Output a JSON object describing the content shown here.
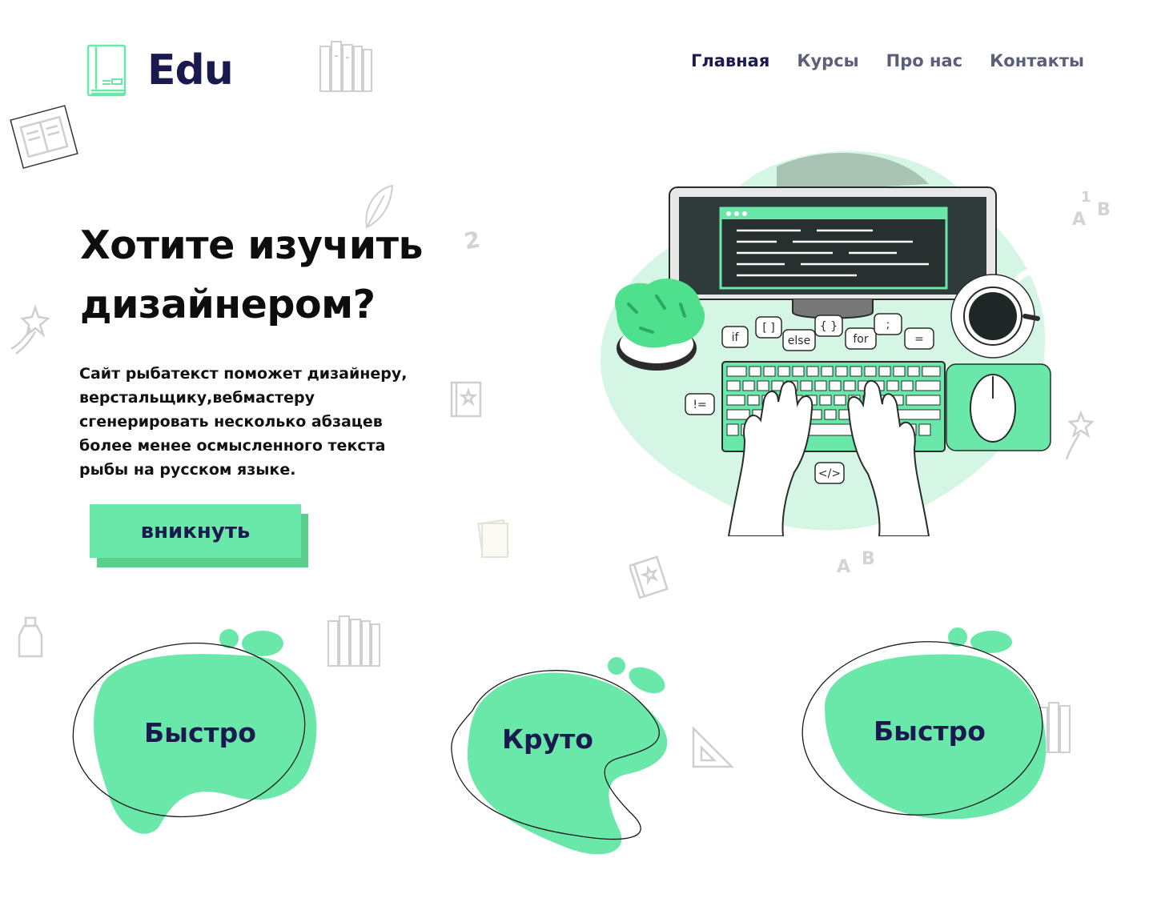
{
  "header": {
    "logo_text": "Edu",
    "nav": [
      {
        "label": "Главная",
        "active": true
      },
      {
        "label": "Курсы",
        "active": false
      },
      {
        "label": "Про нас",
        "active": false
      },
      {
        "label": "Контакты",
        "active": false
      }
    ]
  },
  "hero": {
    "title_line1": "Хотите изучить",
    "title_line2": "дизайнером?",
    "description": "Сайт рыбатекст поможет дизайнеру, верстальщику,вебмастеру сгенерировать несколько абзацев более менее осмысленного текста рыбы на русском языке.",
    "cta_label": "вникнуть"
  },
  "illustration": {
    "code_tags": [
      "if",
      "[ ]",
      "else",
      "{ }",
      "for",
      ";",
      "=",
      "!=",
      "</>"
    ]
  },
  "decor_letters": [
    "A",
    "1",
    "B",
    "2"
  ],
  "features": [
    {
      "label": "Быстро"
    },
    {
      "label": "Круто"
    },
    {
      "label": "Быстро"
    }
  ],
  "colors": {
    "accent": "#6ae8aa",
    "accent_dark": "#5acf8b",
    "navy": "#1a1a4e",
    "muted": "#5b5f7a"
  }
}
